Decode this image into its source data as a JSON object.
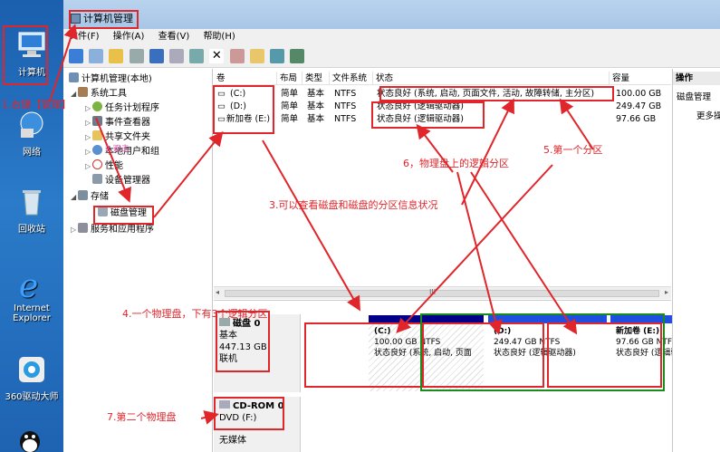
{
  "desktop": {
    "icons": [
      {
        "label": "计算机"
      },
      {
        "label": "网络"
      },
      {
        "label": "回收站"
      },
      {
        "label": "Internet Explorer"
      },
      {
        "label": "360驱动大师"
      }
    ]
  },
  "window": {
    "title": "计算机管理",
    "menu": [
      "文件(F)",
      "操作(A)",
      "查看(V)",
      "帮助(H)"
    ]
  },
  "tree": {
    "root": "计算机管理(本地)",
    "system_tools": "系统工具",
    "task_scheduler": "任务计划程序",
    "event_viewer": "事件查看器",
    "shared_folders": "共享文件夹",
    "local_users": "本地用户和组",
    "performance": "性能",
    "device_manager": "设备管理器",
    "storage": "存储",
    "disk_management": "磁盘管理",
    "services": "服务和应用程序"
  },
  "volumes": {
    "headers": [
      "卷",
      "布局",
      "类型",
      "文件系统",
      "状态",
      "容量"
    ],
    "rows": [
      {
        "name": "(C:)",
        "layout": "简单",
        "type": "基本",
        "fs": "NTFS",
        "status": "状态良好 (系统, 启动, 页面文件, 活动, 故障转储, 主分区)",
        "capacity": "100.00 GB"
      },
      {
        "name": "(D:)",
        "layout": "简单",
        "type": "基本",
        "fs": "NTFS",
        "status": "状态良好 (逻辑驱动器)",
        "capacity": "249.47 GB"
      },
      {
        "name": "新加卷 (E:)",
        "layout": "简单",
        "type": "基本",
        "fs": "NTFS",
        "status": "状态良好 (逻辑驱动器)",
        "capacity": "97.66 GB"
      }
    ]
  },
  "actions": {
    "header": "操作",
    "item": "磁盘管理",
    "more": "更多操"
  },
  "scrollbar": {
    "thumb_glyph": "III"
  },
  "disks": {
    "disk0": {
      "name": "磁盘 0",
      "type": "基本",
      "size": "447.13 GB",
      "status": "联机"
    },
    "cdrom": {
      "name": "CD-ROM 0",
      "drive": "DVD (F:)",
      "media": "无媒体"
    },
    "partitions": [
      {
        "name": "(C:)",
        "size": "100.00 GB NTFS",
        "status": "状态良好 (系统, 启动, 页面"
      },
      {
        "name": "(D:)",
        "size": "249.47 GB NTFS",
        "status": "状态良好 (逻辑驱动器)"
      },
      {
        "name": "新加卷  (E:)",
        "size": "97.66 GB NTFS",
        "status": "状态良好 (逻辑驱动器)"
      }
    ]
  },
  "annotations": {
    "a1": "1.右键【管理】",
    "a2": "2.双击",
    "a3": "3.可以查看磁盘和磁盘的分区信息状况",
    "a4": "4.一个物理盘，下有3个逻辑分区",
    "a5": "5.第一个分区",
    "a6": "6，物理盘上的逻辑分区",
    "a7": "7.第二个物理盘"
  },
  "colors": {
    "annotation": "#e0252b",
    "primary_partition": "#00008b",
    "logical_partition": "#1f4fe0",
    "extended_outline": "#1a8c1a"
  }
}
